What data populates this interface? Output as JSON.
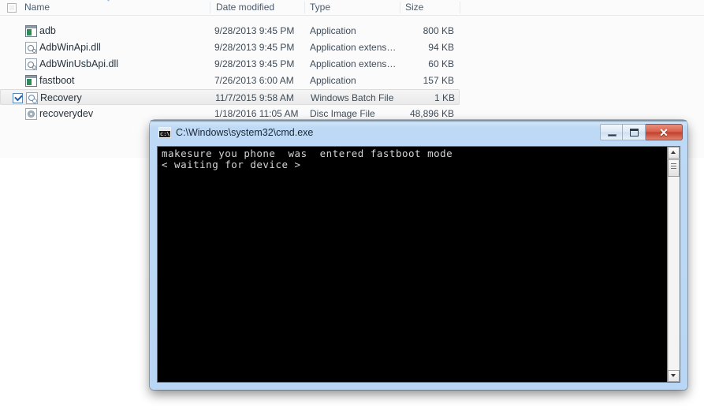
{
  "explorer": {
    "columns": [
      {
        "key": "name",
        "label": "Name"
      },
      {
        "key": "date",
        "label": "Date modified"
      },
      {
        "key": "type",
        "label": "Type"
      },
      {
        "key": "size",
        "label": "Size"
      }
    ],
    "rows": [
      {
        "name": "adb",
        "date": "9/28/2013 9:45 PM",
        "type": "Application",
        "size": "800 KB",
        "icon": "application-icon",
        "selected": false,
        "checked": false
      },
      {
        "name": "AdbWinApi.dll",
        "date": "9/28/2013 9:45 PM",
        "type": "Application extens…",
        "size": "94 KB",
        "icon": "dll-icon",
        "selected": false,
        "checked": false
      },
      {
        "name": "AdbWinUsbApi.dll",
        "date": "9/28/2013 9:45 PM",
        "type": "Application extens…",
        "size": "60 KB",
        "icon": "dll-icon",
        "selected": false,
        "checked": false
      },
      {
        "name": "fastboot",
        "date": "7/26/2013 6:00 AM",
        "type": "Application",
        "size": "157 KB",
        "icon": "application-icon",
        "selected": false,
        "checked": false
      },
      {
        "name": "Recovery",
        "date": "11/7/2015 9:58 AM",
        "type": "Windows Batch File",
        "size": "1 KB",
        "icon": "batch-file-icon",
        "selected": true,
        "checked": true
      },
      {
        "name": "recoverydev",
        "date": "1/18/2016 11:05 AM",
        "type": "Disc Image File",
        "size": "48,896 KB",
        "icon": "disc-image-icon",
        "selected": false,
        "checked": false
      }
    ]
  },
  "cmd_window": {
    "title": "C:\\Windows\\system32\\cmd.exe",
    "icon": "cmd-icon",
    "icon_glyph": "c:\\",
    "controls": {
      "minimize_label": "Minimize",
      "maximize_label": "Maximize",
      "close_label": "✕"
    },
    "console_lines": [
      "makesure you phone  was  entered fastboot mode",
      "< waiting for device >"
    ],
    "scrollbar": {
      "up_label": "Scroll up",
      "down_label": "Scroll down"
    }
  },
  "colors": {
    "window_frame": "#bdd9f5",
    "console_bg": "#000000",
    "console_text": "#d6d6d6",
    "close_button": "#c0402c",
    "selection": "#eaeaea",
    "header_text": "#4a5b6e"
  }
}
